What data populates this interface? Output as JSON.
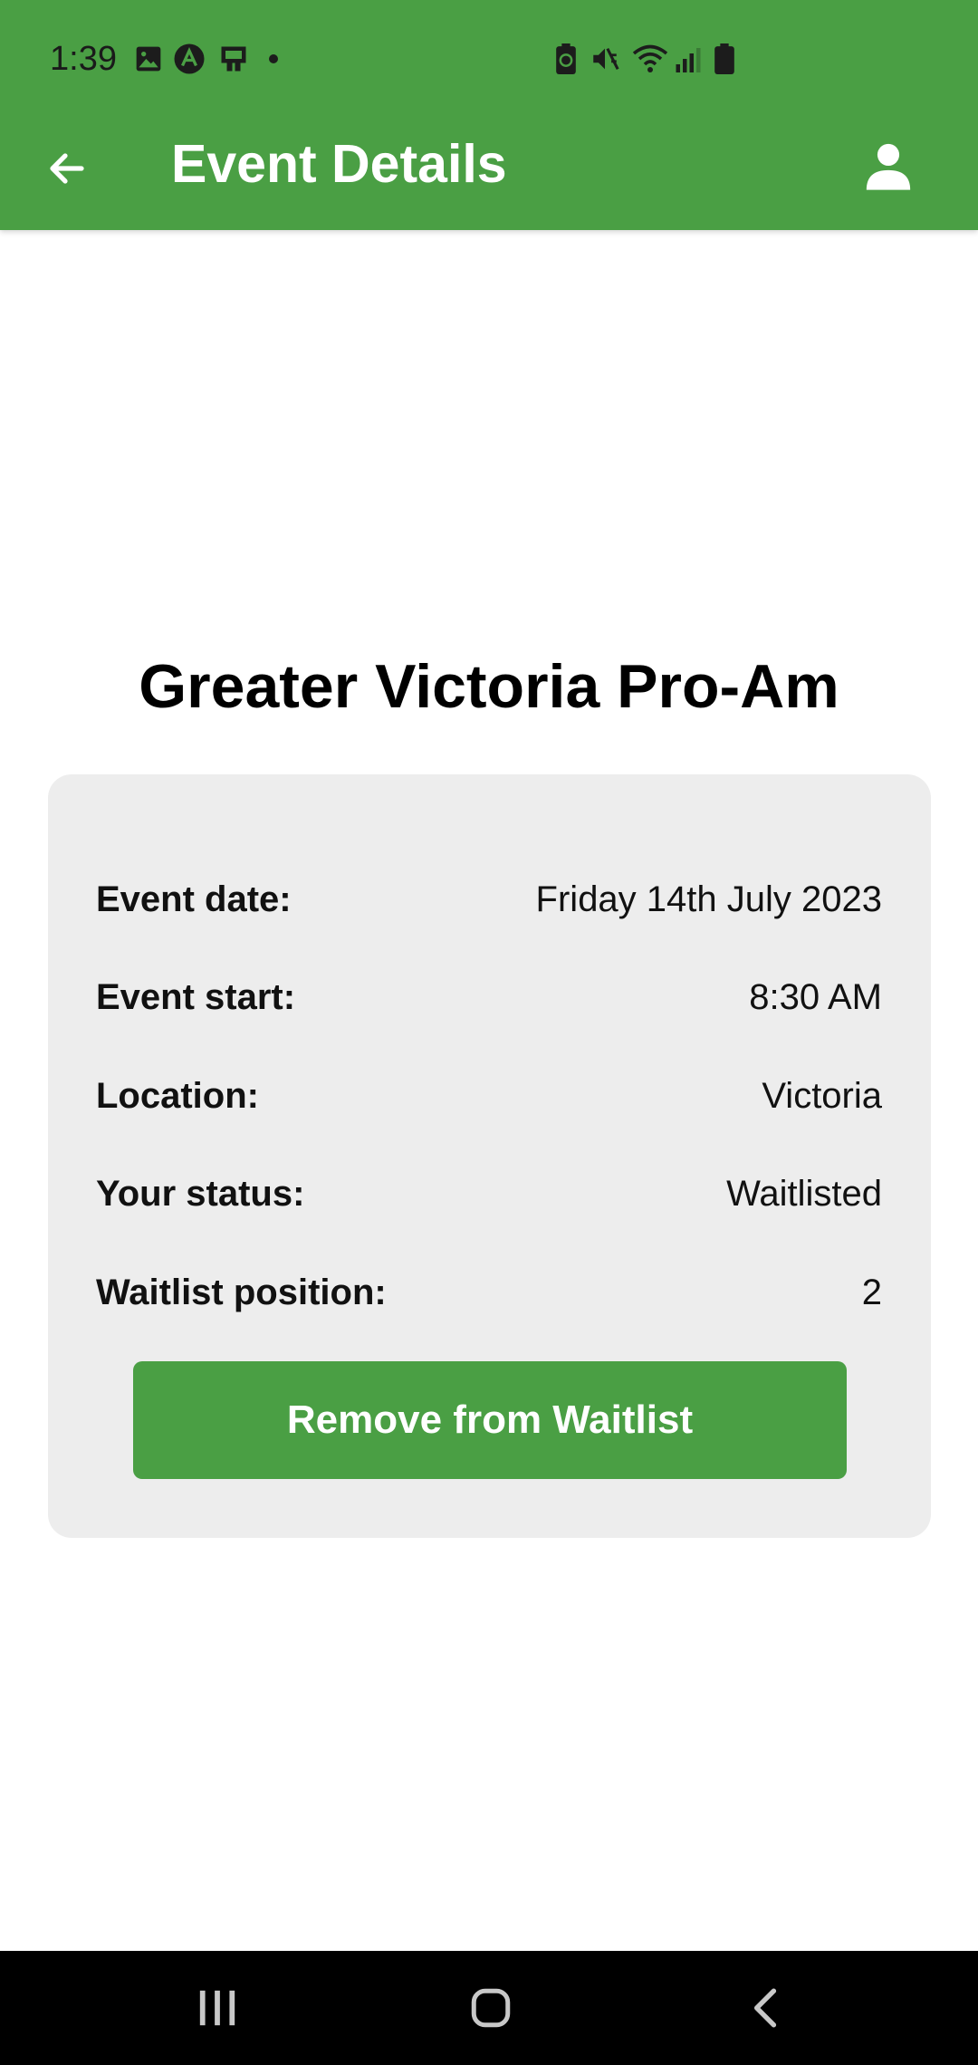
{
  "status_bar": {
    "time": "1:39",
    "left_icons": [
      "gallery-icon",
      "app-a-icon",
      "cast-icon",
      "dot-icon"
    ],
    "right_icons": [
      "battery-saver-icon",
      "mute-icon",
      "wifi-icon",
      "signal-icon",
      "battery-icon"
    ]
  },
  "app_bar": {
    "title": "Event Details",
    "back_icon": "arrow-left-icon",
    "profile_icon": "person-icon"
  },
  "event": {
    "name": "Greater Victoria Pro-Am",
    "details": [
      {
        "label": "Event date:",
        "value": "Friday 14th July 2023"
      },
      {
        "label": "Event start:",
        "value": "8:30 AM"
      },
      {
        "label": "Location:",
        "value": "Victoria"
      },
      {
        "label": "Your status:",
        "value": "Waitlisted"
      },
      {
        "label": "Waitlist position:",
        "value": "2"
      }
    ],
    "action_label": "Remove from Waitlist"
  },
  "nav_bar": {
    "icons": [
      "recents-icon",
      "home-icon",
      "back-icon"
    ]
  },
  "colors": {
    "primary": "#4a9f44",
    "card_background": "#ededed",
    "nav_background": "#000000"
  }
}
